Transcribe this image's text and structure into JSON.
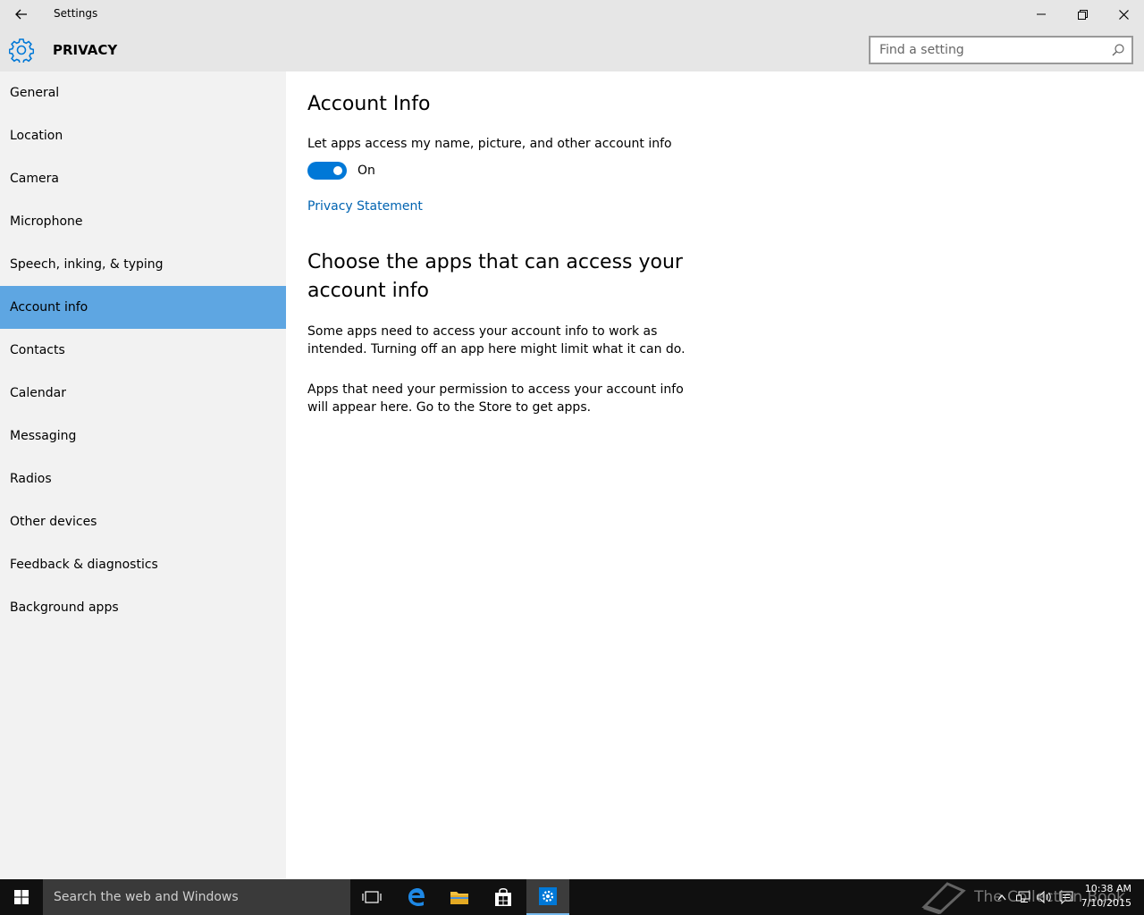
{
  "window": {
    "title": "Settings",
    "minimize_glyph": "—",
    "maximize_glyph": "❐",
    "close_glyph": "✕"
  },
  "header": {
    "title": "PRIVACY",
    "search_placeholder": "Find a setting"
  },
  "sidebar": {
    "items": [
      {
        "label": "General"
      },
      {
        "label": "Location"
      },
      {
        "label": "Camera"
      },
      {
        "label": "Microphone"
      },
      {
        "label": "Speech, inking, & typing"
      },
      {
        "label": "Account info",
        "selected": true
      },
      {
        "label": "Contacts"
      },
      {
        "label": "Calendar"
      },
      {
        "label": "Messaging"
      },
      {
        "label": "Radios"
      },
      {
        "label": "Other devices"
      },
      {
        "label": "Feedback & diagnostics"
      },
      {
        "label": "Background apps"
      }
    ]
  },
  "main": {
    "title": "Account Info",
    "toggle_label": "Let apps access my name, picture, and other account info",
    "toggle_on": true,
    "toggle_state": "On",
    "privacy_link": "Privacy Statement",
    "section_title": "Choose the apps that can access your account info",
    "para1": "Some apps need to access your account info to work as intended. Turning off an app here might limit what it can do.",
    "para2": "Apps that need your permission to access your account info will appear here. Go to the Store to get apps."
  },
  "taskbar": {
    "search_placeholder": "Search the web and Windows",
    "watermark": "The Collection Book",
    "time": "10:38 AM",
    "date": "7/10/2015"
  },
  "colors": {
    "accent": "#0078d7",
    "selected_nav": "#5ea6e2",
    "link": "#0063b1",
    "chrome": "#e6e6e6",
    "sidebar": "#f2f2f2",
    "taskbar": "#101010"
  }
}
